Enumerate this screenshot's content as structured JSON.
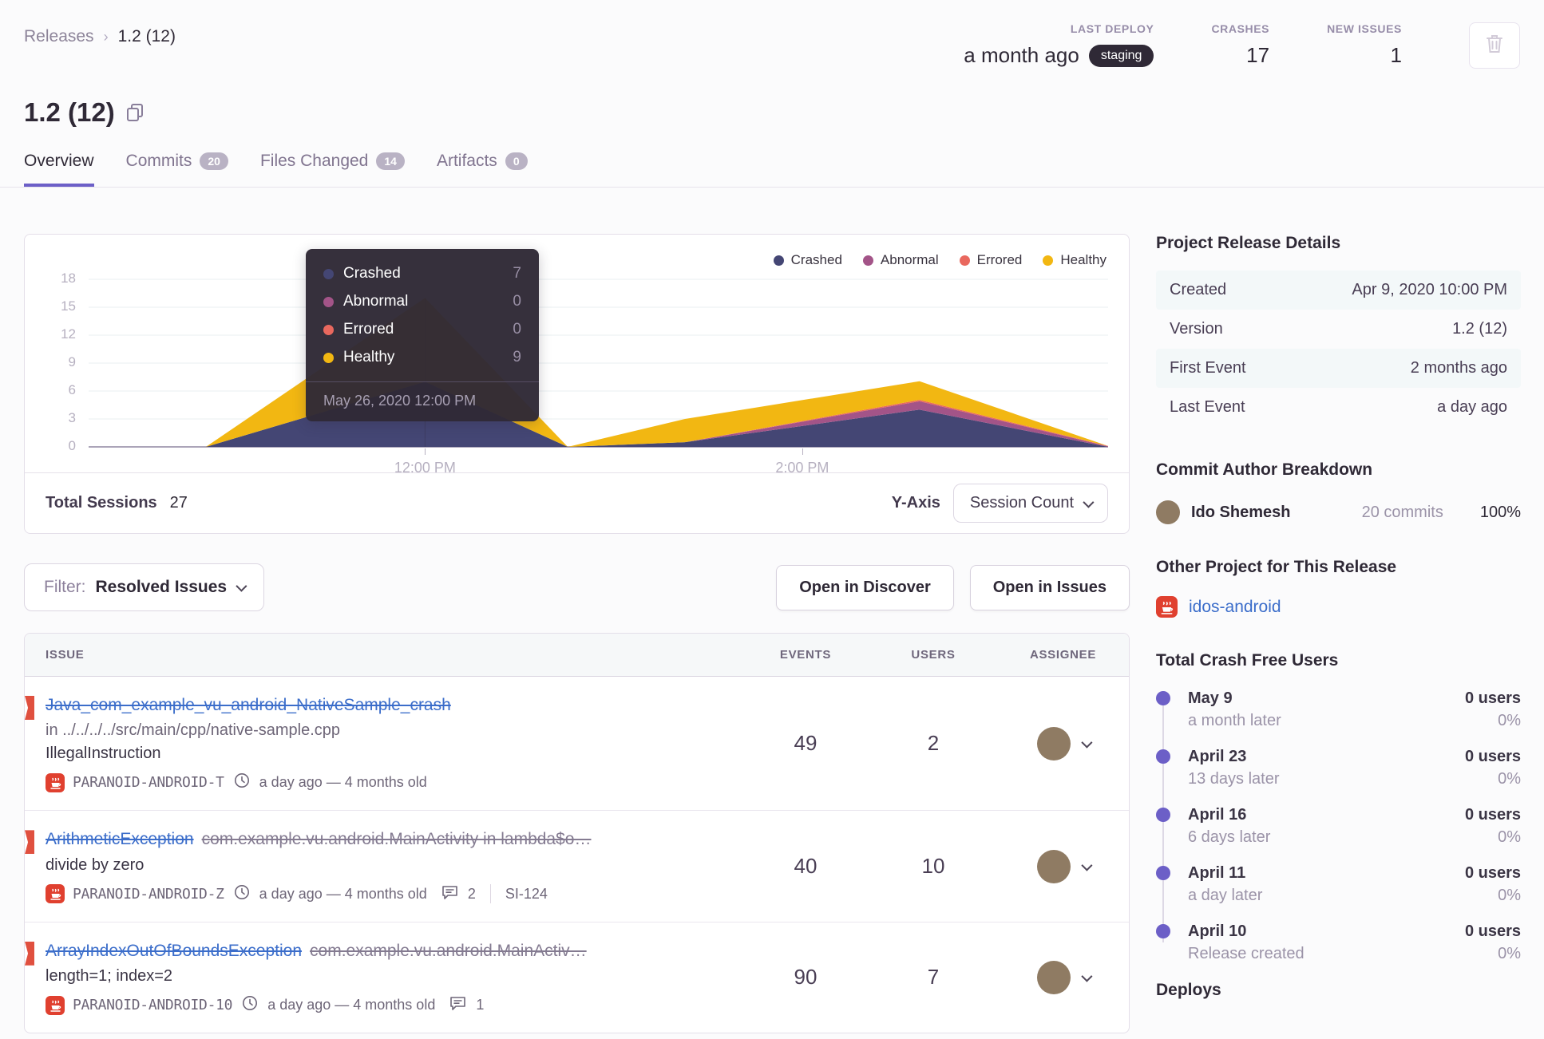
{
  "breadcrumb": {
    "root": "Releases",
    "current": "1.2 (12)"
  },
  "header_stats": {
    "last_deploy": {
      "label": "LAST DEPLOY",
      "value": "a month ago",
      "env": "staging"
    },
    "crashes": {
      "label": "CRASHES",
      "value": "17"
    },
    "new_issues": {
      "label": "NEW ISSUES",
      "value": "1"
    }
  },
  "title": "1.2 (12)",
  "tabs": [
    {
      "label": "Overview"
    },
    {
      "label": "Commits",
      "badge": "20"
    },
    {
      "label": "Files Changed",
      "badge": "14"
    },
    {
      "label": "Artifacts",
      "badge": "0"
    }
  ],
  "chart_data": {
    "type": "area",
    "stacked": true,
    "grid": true,
    "legend_position": "top-right",
    "ylim": [
      0,
      18
    ],
    "y_ticks": [
      0,
      3,
      6,
      9,
      12,
      15,
      18
    ],
    "x_tick_labels": [
      {
        "label": "12:00 PM",
        "frac": 0.33
      },
      {
        "label": "2:00 PM",
        "frac": 0.7
      }
    ],
    "x_frac": [
      0,
      0.115,
      0.33,
      0.47,
      0.585,
      0.815,
      1.0
    ],
    "series": [
      {
        "name": "Crashed",
        "color": "#444674",
        "values": [
          0,
          0,
          7,
          0,
          0.5,
          4,
          0
        ]
      },
      {
        "name": "Abnormal",
        "color": "#a35488",
        "values": [
          0,
          0,
          0,
          0,
          0,
          0.9,
          0.05
        ]
      },
      {
        "name": "Errored",
        "color": "#e9685e",
        "values": [
          0,
          0,
          0,
          0,
          0,
          0.15,
          0.05
        ]
      },
      {
        "name": "Healthy",
        "color": "#f2b712",
        "values": [
          0,
          0,
          9,
          0,
          2.5,
          2,
          0
        ]
      }
    ],
    "tooltip": {
      "values": [
        "7",
        "0",
        "0",
        "9"
      ],
      "title": "May 26, 2020 12:00 PM",
      "anchor_frac": 0.33
    },
    "footer": {
      "total_label": "Total Sessions",
      "total_value": "27",
      "yaxis_label": "Y-Axis",
      "yaxis_value": "Session Count"
    }
  },
  "filter": {
    "label": "Filter:",
    "value": "Resolved Issues"
  },
  "actions": {
    "discover": "Open in Discover",
    "issues": "Open in Issues"
  },
  "issues_table": {
    "columns": {
      "issue": "ISSUE",
      "events": "EVENTS",
      "users": "USERS",
      "assignee": "ASSIGNEE"
    },
    "rows": [
      {
        "title": "Java_com_example_vu_android_NativeSample_crash",
        "culprit": "",
        "sub1": "in ../../../../src/main/cpp/native-sample.cpp",
        "sub2": "IllegalInstruction",
        "project": "PARANOID-ANDROID-T",
        "age": "a day ago — 4 months old",
        "comments": "",
        "short_id": "",
        "events": "49",
        "users": "2"
      },
      {
        "title": "ArithmeticException",
        "culprit": "com.example.vu.android.MainActivity in lambda$o…",
        "sub1": "divide by zero",
        "sub2": "",
        "project": "PARANOID-ANDROID-Z",
        "age": "a day ago — 4 months old",
        "comments": "2",
        "short_id": "SI-124",
        "events": "40",
        "users": "10"
      },
      {
        "title": "ArrayIndexOutOfBoundsException",
        "culprit": "com.example.vu.android.MainActiv…",
        "sub1": "length=1; index=2",
        "sub2": "",
        "project": "PARANOID-ANDROID-10",
        "age": "a day ago — 4 months old",
        "comments": "1",
        "short_id": "",
        "events": "90",
        "users": "7"
      }
    ]
  },
  "sidebar": {
    "release_details": {
      "heading": "Project Release Details",
      "rows": [
        {
          "label": "Created",
          "value": "Apr 9, 2020 10:00 PM"
        },
        {
          "label": "Version",
          "value": "1.2 (12)"
        },
        {
          "label": "First Event",
          "value": "2 months ago"
        },
        {
          "label": "Last Event",
          "value": "a day ago"
        }
      ]
    },
    "commit_authors": {
      "heading": "Commit Author Breakdown",
      "author": {
        "name": "Ido Shemesh",
        "commits": "20 commits",
        "percent": "100%"
      }
    },
    "other_project": {
      "heading": "Other Project for This Release",
      "link": "idos-android"
    },
    "crash_free": {
      "heading": "Total Crash Free Users",
      "entries": [
        {
          "date": "May 9",
          "caption": "a month later",
          "users": "0 users",
          "percent": "0%"
        },
        {
          "date": "April 23",
          "caption": "13 days later",
          "users": "0 users",
          "percent": "0%"
        },
        {
          "date": "April 16",
          "caption": "6 days later",
          "users": "0 users",
          "percent": "0%"
        },
        {
          "date": "April 11",
          "caption": "a day later",
          "users": "0 users",
          "percent": "0%"
        },
        {
          "date": "April 10",
          "caption": "Release created",
          "users": "0 users",
          "percent": "0%"
        }
      ]
    },
    "deploys_heading": "Deploys"
  },
  "colors": {
    "accent": "#6c5fc7",
    "link": "#3b6dca",
    "danger": "#e0503f",
    "pill_dark": "#2f2936"
  }
}
